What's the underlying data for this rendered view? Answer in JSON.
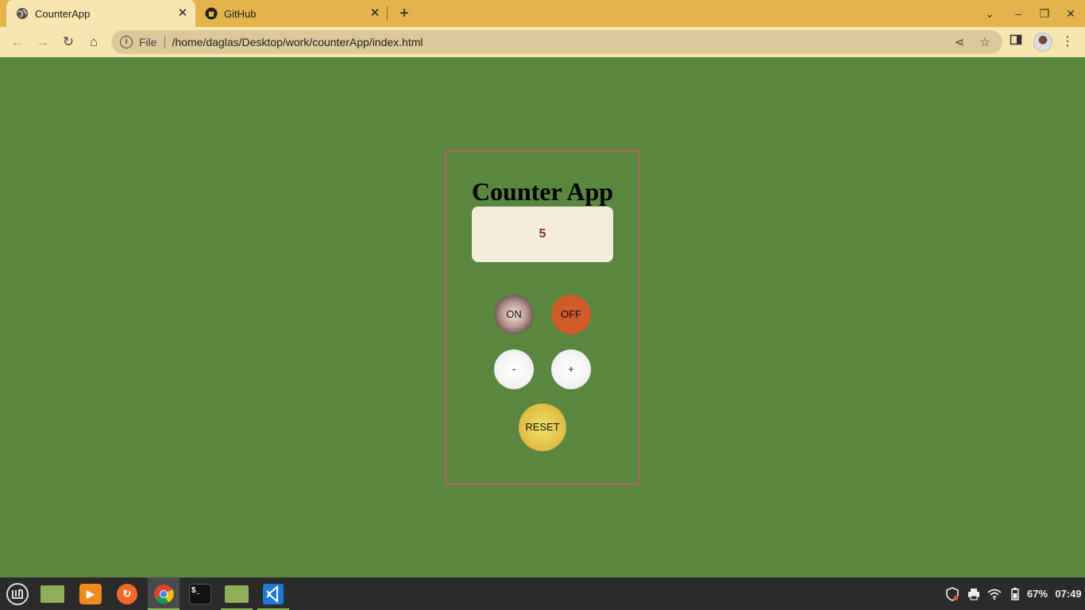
{
  "browser": {
    "tabs": [
      {
        "title": "CounterApp",
        "icon": "globe-icon",
        "active": true
      },
      {
        "title": "GitHub",
        "icon": "github-icon",
        "active": false
      }
    ],
    "new_tab_label": "+",
    "address": {
      "scheme_label": "File",
      "url": "/home/daglas/Desktop/work/counterApp/index.html"
    }
  },
  "app": {
    "title": "Counter App",
    "count": "5",
    "buttons": {
      "on": "ON",
      "off": "OFF",
      "minus": "-",
      "plus": "+",
      "reset": "RESET"
    },
    "colors": {
      "background": "#5a8640",
      "card_border": "#b0665a",
      "display_bg": "#f5ecdc",
      "off_button": "#cf5a2a",
      "reset_button": "#e3c14a"
    }
  },
  "taskbar": {
    "apps": [
      "mint-menu-icon",
      "show-desktop-icon",
      "media-player-icon",
      "firefox-icon",
      "chrome-icon",
      "terminal-icon",
      "files-icon",
      "vscode-icon"
    ],
    "battery": "67%",
    "time": "07:49"
  }
}
